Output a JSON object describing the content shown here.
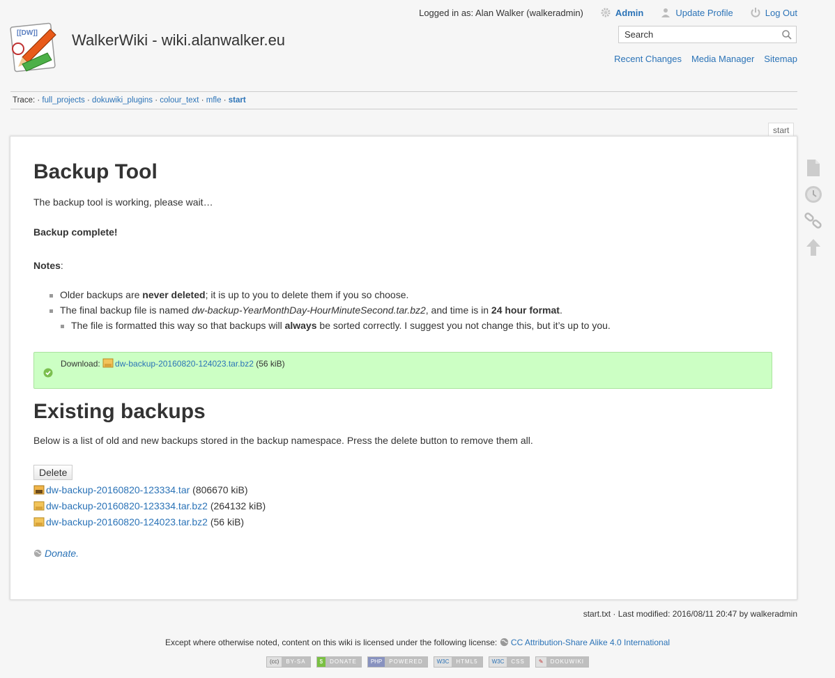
{
  "site": {
    "title": "WalkerWiki - wiki.alanwalker.eu"
  },
  "usertools": {
    "logged_in": "Logged in as: Alan Walker (walkeradmin)",
    "admin": "Admin",
    "update_profile": "Update Profile",
    "logout": "Log Out"
  },
  "search": {
    "placeholder": "Search"
  },
  "sitetools": {
    "recent_changes": "Recent Changes",
    "media_manager": "Media Manager",
    "sitemap": "Sitemap"
  },
  "trace": {
    "label": "Trace:",
    "items": [
      "full_projects",
      "dokuwiki_plugins",
      "colour_text",
      "mfle",
      "start"
    ],
    "separator": "·"
  },
  "page": {
    "tab": "start",
    "h1_backup": "Backup Tool",
    "working_text": "The backup tool is working, please wait…",
    "complete_text": "Backup complete!",
    "notes_label": "Notes",
    "notes_colon": ":",
    "note1_pre": "Older backups are ",
    "note1_bold": "never deleted",
    "note1_post": "; it is up to you to delete them if you so choose.",
    "note2_pre": "The final backup file is named ",
    "note2_italic": "dw-backup-YearMonthDay-HourMinuteSecond.tar.bz2",
    "note2_mid": ", and time is in ",
    "note2_bold": "24 hour format",
    "note2_post": ".",
    "note3_pre": "The file is formatted this way so that backups will ",
    "note3_bold": "always",
    "note3_post": " be sorted correctly. I suggest you not change this, but it’s up to you.",
    "download_label": "Download:",
    "download_file": "dw-backup-20160820-124023.tar.bz2",
    "download_size": "(56 kiB)",
    "h1_existing": "Existing backups",
    "existing_text": "Below is a list of old and new backups stored in the backup namespace. Press the delete button to remove them all.",
    "delete_label": "Delete",
    "files": [
      {
        "name": "dw-backup-20160820-123334.tar",
        "size": "(806670 kiB)",
        "type": "tar"
      },
      {
        "name": "dw-backup-20160820-123334.tar.bz2",
        "size": "(264132 kiB)",
        "type": "bz2"
      },
      {
        "name": "dw-backup-20160820-124023.tar.bz2",
        "size": "(56 kiB)",
        "type": "bz2"
      }
    ],
    "donate": "Donate."
  },
  "footer": {
    "docinfo": "start.txt · Last modified: 2016/08/11 20:47 by walkeradmin",
    "license_pre": "Except where otherwise noted, content on this wiki is licensed under the following license:",
    "license_link": "CC Attribution-Share Alike 4.0 International",
    "badges": [
      {
        "left": "(cc)",
        "right": "BY-SA"
      },
      {
        "left": "$",
        "right": "DONATE"
      },
      {
        "left": "PHP",
        "right": "POWERED"
      },
      {
        "left": "W3C",
        "right": "HTML5"
      },
      {
        "left": "W3C",
        "right": "CSS"
      },
      {
        "left": "✎",
        "right": "DOKUWIKI"
      }
    ]
  },
  "colors": {
    "link": "#2b73b7",
    "success_bg": "#ccffc4",
    "success_border": "#aae39e"
  }
}
